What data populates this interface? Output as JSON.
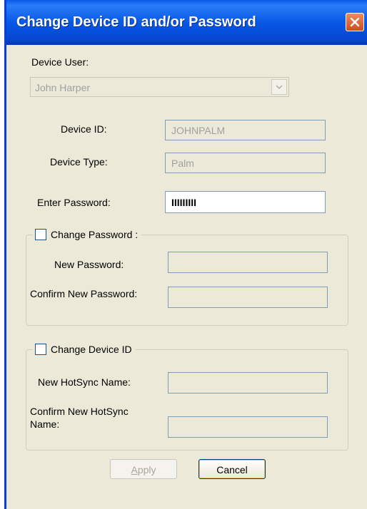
{
  "window": {
    "title": "Change Device ID and/or Password",
    "close_icon": "close-icon"
  },
  "device_user": {
    "label": "Device User:",
    "selected": "John Harper",
    "dropdown_icon": "chevron-down-icon"
  },
  "device_id": {
    "label": "Device ID:",
    "value": "JOHNPALM"
  },
  "device_type": {
    "label": "Device Type:",
    "value": "Palm"
  },
  "enter_password": {
    "label": "Enter Password:",
    "value": "IIIIIIIII"
  },
  "change_password": {
    "checkbox_label": "Change Password :",
    "checked": false,
    "new_password_label": "New Password:",
    "confirm_password_label": "Confirm New Password:"
  },
  "change_device_id": {
    "checkbox_label": "Change  Device ID",
    "checked": false,
    "new_hotsync_label": "New HotSync Name:",
    "confirm_hotsync_label_line1": "Confirm New HotSync",
    "confirm_hotsync_label_line2": "Name:"
  },
  "buttons": {
    "apply_accel": "A",
    "apply_rest": "pply",
    "cancel": "Cancel"
  },
  "colors": {
    "titlebar": "#0858e6",
    "dialog_bg": "#ece9d8",
    "close_button": "#d04c1c"
  }
}
